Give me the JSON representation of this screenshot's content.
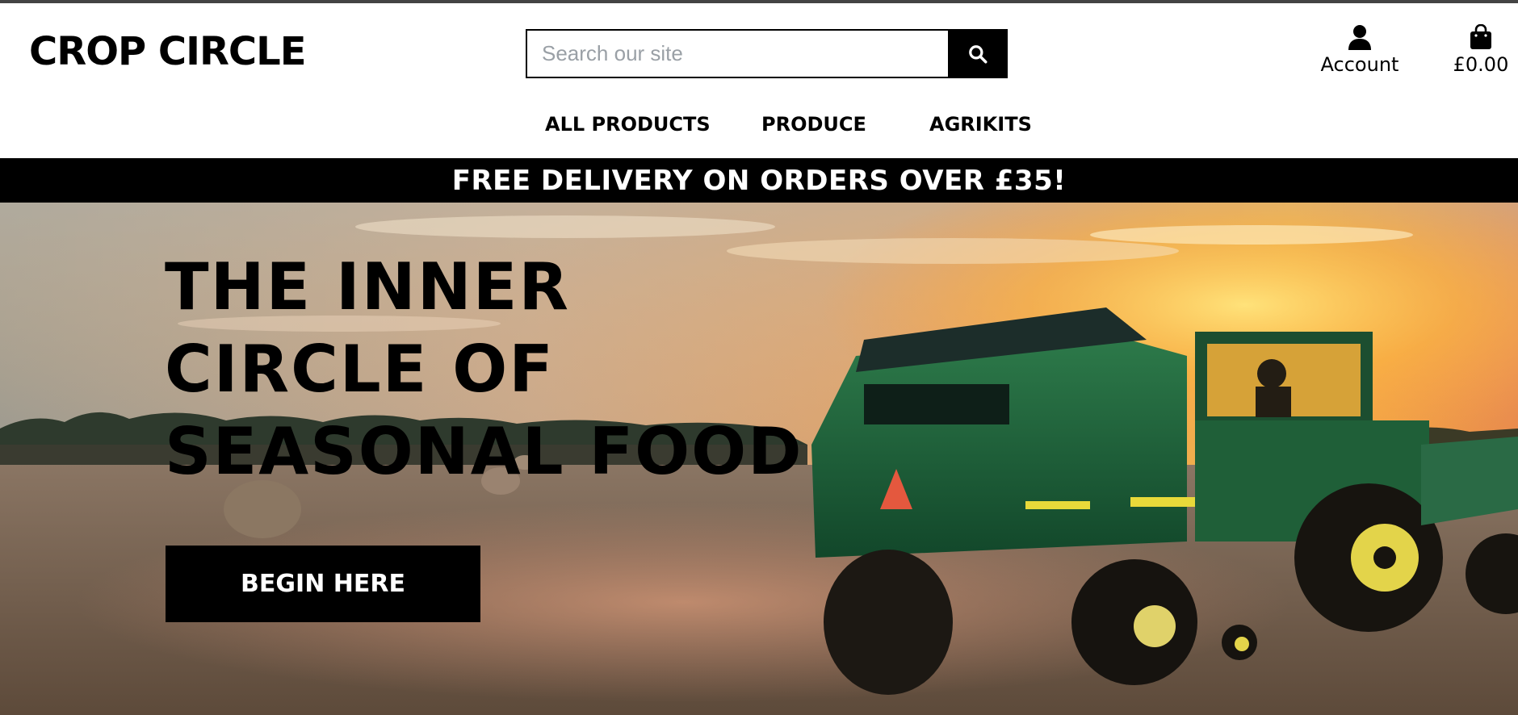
{
  "brand": {
    "logo_text": "CROP CIRCLE"
  },
  "search": {
    "placeholder": "Search our site",
    "value": "",
    "button_icon": "search-icon"
  },
  "header_actions": {
    "account": {
      "label": "Account",
      "icon": "user-icon"
    },
    "cart": {
      "label": "£0.00",
      "icon": "shopping-bag-icon"
    }
  },
  "nav": {
    "items": [
      {
        "label": "ALL PRODUCTS"
      },
      {
        "label": "PRODUCE"
      },
      {
        "label": "AGRIKITS"
      }
    ]
  },
  "banner": {
    "text": "FREE DELIVERY ON ORDERS OVER £35!"
  },
  "hero": {
    "title_lines": [
      "THE INNER",
      "CIRCLE OF",
      "SEASONAL FOOD"
    ],
    "cta_label": "BEGIN HERE",
    "image_description": ""
  },
  "colors": {
    "primary": "#000000",
    "background": "#ffffff",
    "text_on_dark": "#ffffff",
    "tractor_green": "#1f6b3a",
    "tractor_yellow": "#e8d93a",
    "sky_orange": "#f5a623"
  }
}
